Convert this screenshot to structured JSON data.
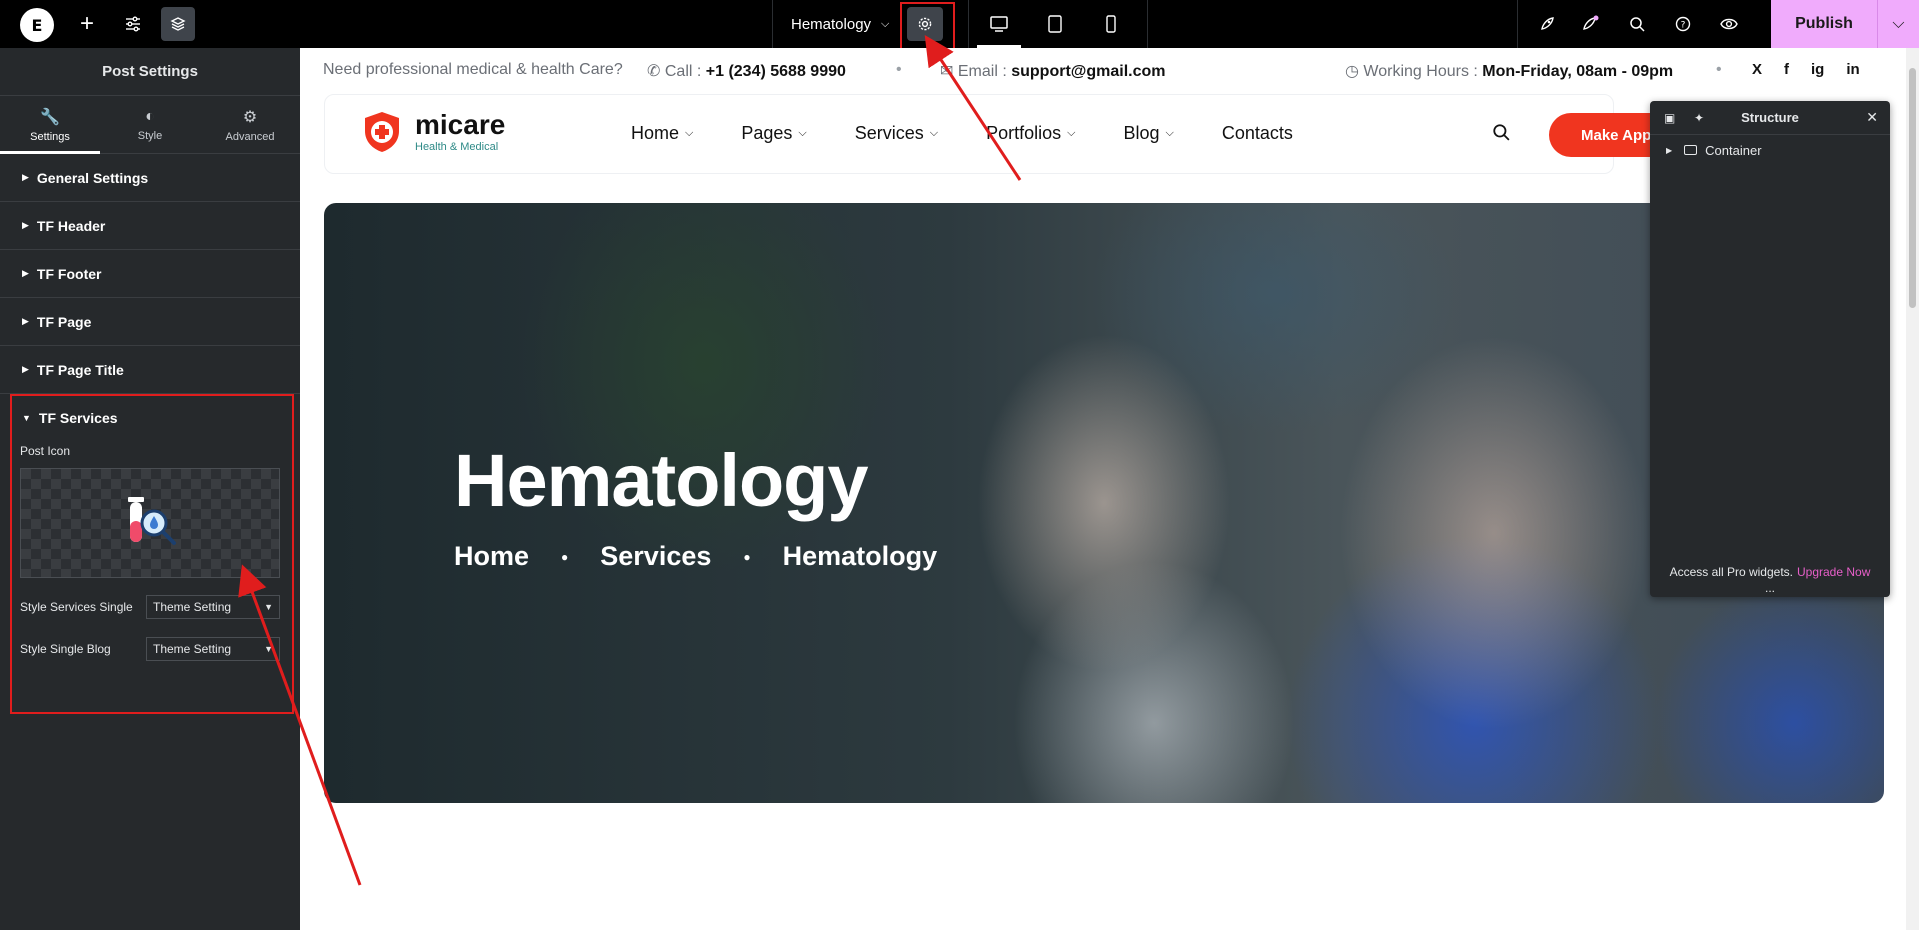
{
  "topbar": {
    "doc_title": "Hematology",
    "publish_label": "Publish",
    "logo_letter": "E",
    "icons": {
      "logo": "elementor-logo-icon",
      "add": "plus-icon",
      "settings": "sliders-icon",
      "layers": "layers-icon",
      "page_settings": "gear-icon",
      "desktop": "desktop-icon",
      "tablet": "tablet-icon",
      "mobile": "mobile-icon",
      "rocket": "rocket-icon",
      "notifications": "notification-icon",
      "search": "search-icon",
      "help": "help-icon",
      "preview": "eye-icon"
    }
  },
  "panel": {
    "title": "Post Settings",
    "tabs": [
      {
        "label": "Settings",
        "icon": "wrench-icon"
      },
      {
        "label": "Style",
        "icon": "half-circle-icon"
      },
      {
        "label": "Advanced",
        "icon": "gear-icon"
      }
    ],
    "sections": [
      {
        "label": "General Settings"
      },
      {
        "label": "TF Header"
      },
      {
        "label": "TF Footer"
      },
      {
        "label": "TF Page"
      },
      {
        "label": "TF Page Title"
      }
    ],
    "tf_services": {
      "label": "TF Services",
      "post_icon_label": "Post Icon",
      "style_services_single_label": "Style Services Single",
      "style_services_single_value": "Theme Setting",
      "style_single_blog_label": "Style Single Blog",
      "style_single_blog_value": "Theme Setting"
    }
  },
  "site": {
    "top_info": {
      "need": "Need professional medical & health Care?",
      "call_label": "Call :",
      "call_value": "+1 (234) 5688 9990",
      "email_label": "Email :",
      "email_value": "support@gmail.com",
      "hours_label": "Working Hours :",
      "hours_value": "Mon-Friday, 08am - 09pm"
    },
    "social": [
      "X",
      "f",
      "ig",
      "in"
    ],
    "brand": {
      "name": "micare",
      "tagline": "Health & Medical"
    },
    "nav": [
      "Home",
      "Pages",
      "Services",
      "Portfolios",
      "Blog",
      "Contacts"
    ],
    "cta_label": "Make Appo",
    "hero": {
      "title": "Hematology",
      "breadcrumbs": [
        "Home",
        "Services",
        "Hematology"
      ]
    }
  },
  "structure": {
    "title": "Structure",
    "item": "Container",
    "footer_text": "Access all Pro widgets.",
    "upgrade_label": "Upgrade Now",
    "dots": "..."
  },
  "colors": {
    "accent_publish": "#f0abfc",
    "cta": "#f0351f",
    "annotation": "#e01d1d",
    "upgrade": "#e75fc9"
  }
}
